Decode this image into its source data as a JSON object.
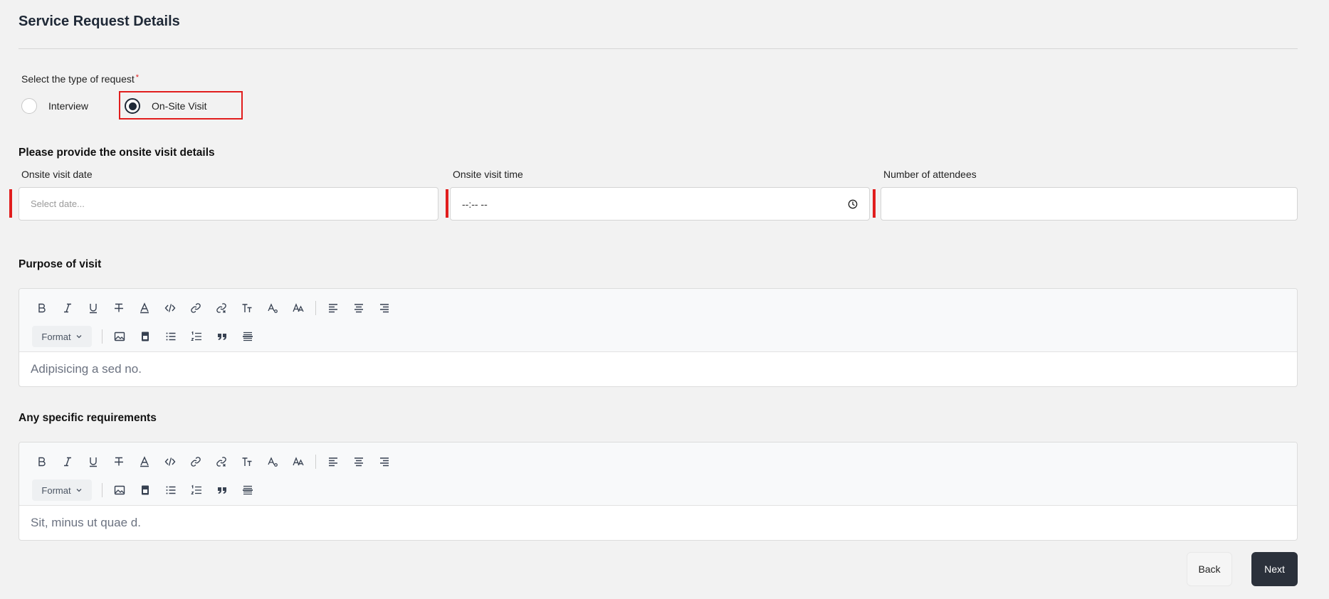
{
  "header": {
    "title": "Service Request Details"
  },
  "request_type": {
    "label": "Select the type of request",
    "required_mark": "*",
    "options": [
      {
        "label": "Interview",
        "selected": false
      },
      {
        "label": "On-Site Visit",
        "selected": true
      }
    ]
  },
  "onsite": {
    "heading": "Please provide the onsite visit details",
    "date": {
      "label": "Onsite visit date",
      "placeholder": "Select date..."
    },
    "time": {
      "label": "Onsite visit time",
      "value": "--:-- --"
    },
    "attendees": {
      "label": "Number of attendees",
      "value": ""
    }
  },
  "purpose": {
    "heading": "Purpose of visit",
    "content": "Adipisicing a sed no."
  },
  "requirements": {
    "heading": "Any specific requirements",
    "content": "Sit, minus ut quae d."
  },
  "toolbar": {
    "format_label": "Format"
  },
  "actions": {
    "back_label": "Back",
    "next_label": "Next"
  },
  "colors": {
    "accent": "#2b313b",
    "error": "#e11d1d",
    "background": "#f2f2f2"
  }
}
